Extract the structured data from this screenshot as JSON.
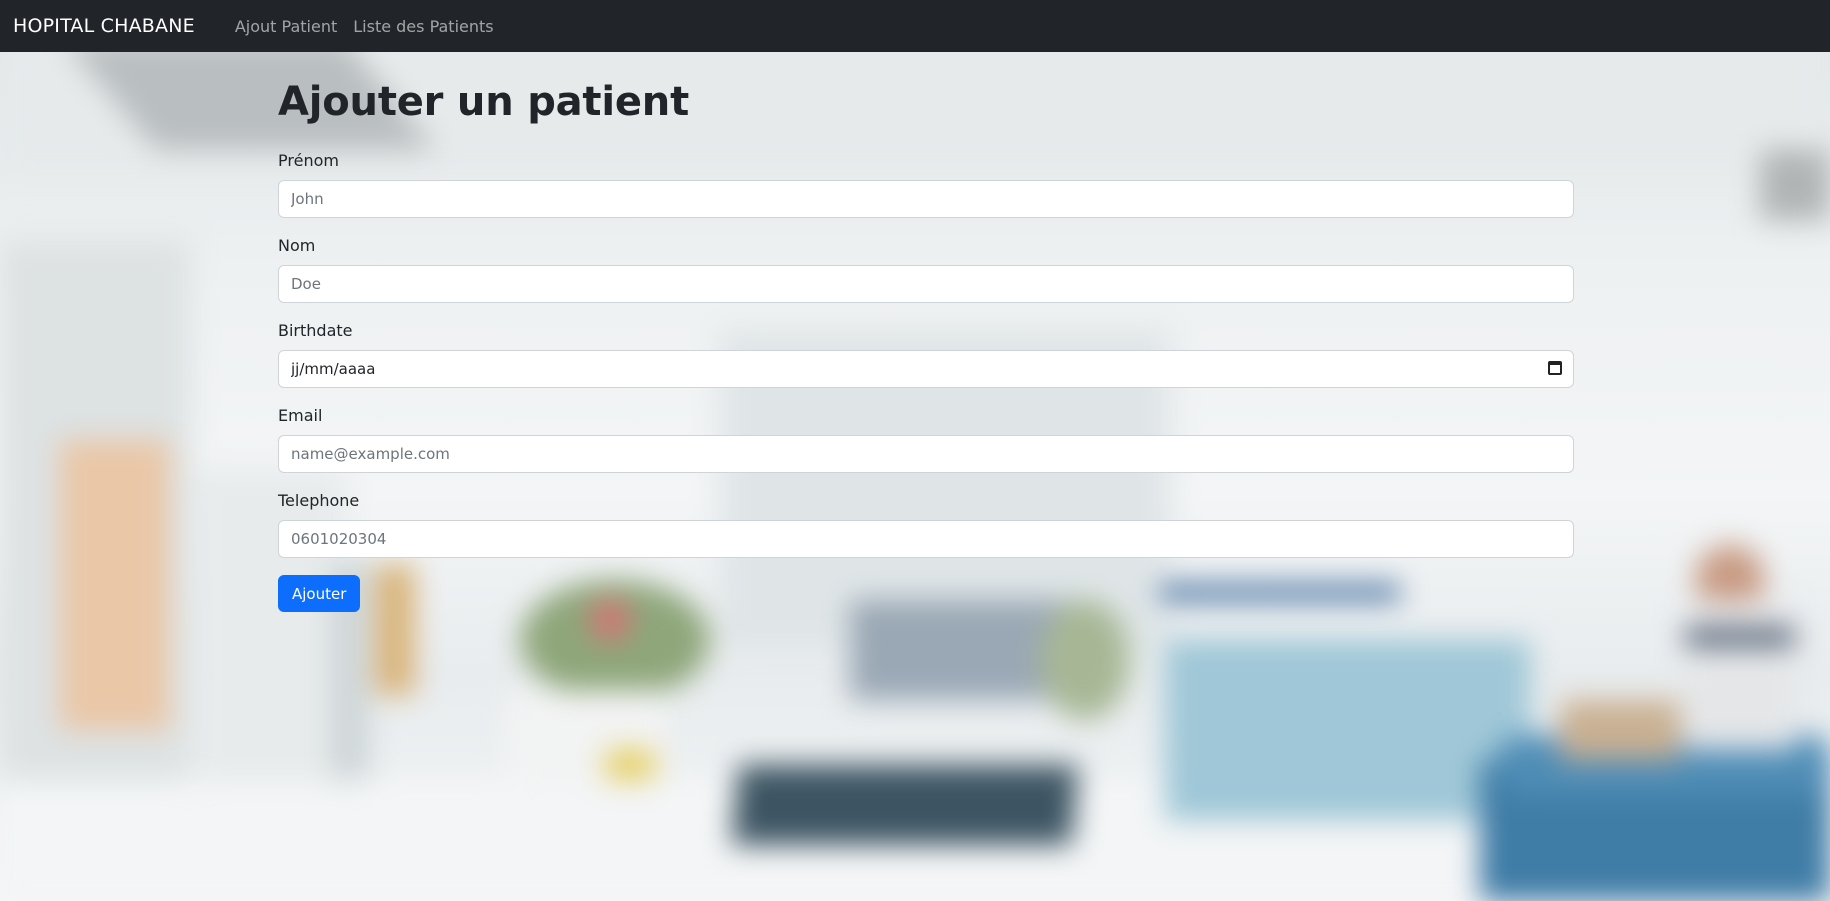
{
  "navbar": {
    "brand": "HOPITAL CHABANE",
    "links": [
      "Ajout Patient",
      "Liste des Patients"
    ]
  },
  "page": {
    "title": "Ajouter un patient"
  },
  "form": {
    "firstname": {
      "label": "Prénom",
      "placeholder": "John",
      "value": ""
    },
    "lastname": {
      "label": "Nom",
      "placeholder": "Doe",
      "value": ""
    },
    "birthdate": {
      "label": "Birthdate",
      "placeholder": "jj/mm/aaaa",
      "value": ""
    },
    "email": {
      "label": "Email",
      "placeholder": "name@example.com",
      "value": ""
    },
    "telephone": {
      "label": "Telephone",
      "placeholder": "0601020304",
      "value": ""
    },
    "submit_label": "Ajouter"
  },
  "colors": {
    "navbar_bg": "#212529",
    "primary": "#0d6efd",
    "text": "#212529"
  },
  "icons": {
    "date_picker": "calendar-icon"
  }
}
